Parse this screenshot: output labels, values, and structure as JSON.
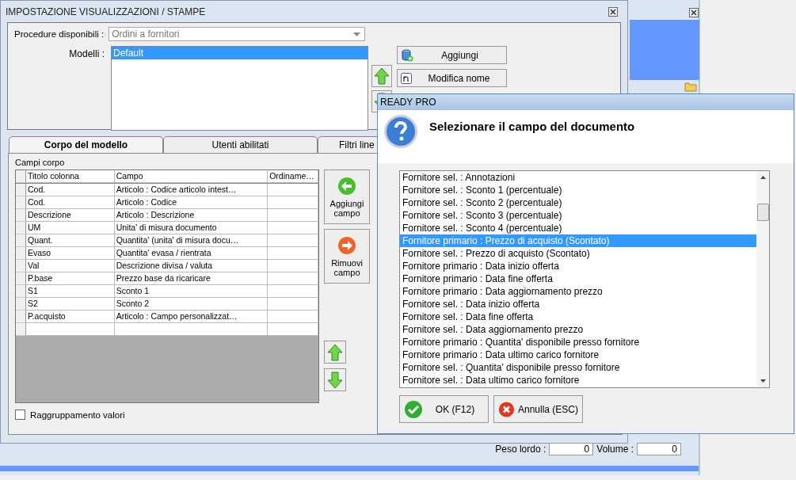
{
  "background_window": {
    "fields": [
      {
        "label": "Peso lordo :",
        "value": "0"
      },
      {
        "label": "Volume :",
        "value": "0"
      }
    ]
  },
  "settings_window": {
    "title": "IMPOSTAZIONE VISUALIZZAZIONI / STAMPE",
    "procedure": {
      "label": "Procedure disponibili :",
      "value": "Ordini a fornitori"
    },
    "models": {
      "label": "Modelli :",
      "items": [
        {
          "name": "Default",
          "selected": true
        }
      ]
    },
    "model_buttons": [
      {
        "label": "Aggiungi",
        "kind": "add"
      },
      {
        "label": "Modifica nome",
        "kind": "rename"
      }
    ],
    "tabs": [
      {
        "label": "Corpo del modello",
        "selected": true
      },
      {
        "label": "Utenti abilitati",
        "selected": false
      },
      {
        "label": "Filtri line",
        "selected": false
      }
    ],
    "section_label": "Campi corpo",
    "table": {
      "columns": [
        "Titolo colonna",
        "Campo",
        "Ordiname…"
      ],
      "rows": [
        [
          "Cod.",
          "Articolo : Codice articolo intest…",
          ""
        ],
        [
          "Cod.",
          "Articolo : Codice",
          ""
        ],
        [
          "Descrizione",
          "Articolo : Descrizione",
          ""
        ],
        [
          "UM",
          "Unita' di misura documento",
          ""
        ],
        [
          "Quant.",
          "Quantita' (unita' di misura docu…",
          ""
        ],
        [
          "Evaso",
          "Quantita' evasa / rientrata",
          ""
        ],
        [
          "Val",
          "Descrizione divisa / valuta",
          ""
        ],
        [
          "P.base",
          "Prezzo base da ricaricare",
          ""
        ],
        [
          "S1",
          "Sconto 1",
          ""
        ],
        [
          "S2",
          "Sconto 2",
          ""
        ],
        [
          "P.acquisto",
          "Articolo : Campo personalizzat…",
          ""
        ],
        [
          "",
          "",
          ""
        ]
      ]
    },
    "side_buttons": [
      {
        "label": "Aggiungi campo",
        "kind": "add"
      },
      {
        "label": "Rimuovi campo",
        "kind": "remove"
      }
    ],
    "grouping": {
      "label": "Raggruppamento valori",
      "checked": false
    }
  },
  "dialog": {
    "title": "READY PRO",
    "heading": "Selezionare il campo del documento",
    "items": [
      {
        "label": "Fornitore sel. : Annotazioni",
        "selected": false
      },
      {
        "label": "Fornitore sel. : Sconto 1 (percentuale)",
        "selected": false
      },
      {
        "label": "Fornitore sel. : Sconto 2 (percentuale)",
        "selected": false
      },
      {
        "label": "Fornitore sel. : Sconto 3 (percentuale)",
        "selected": false
      },
      {
        "label": "Fornitore sel. : Sconto 4 (percentuale)",
        "selected": false
      },
      {
        "label": "Fornitore primario : Prezzo di acquisto (Scontato)",
        "selected": true
      },
      {
        "label": "Fornitore sel. : Prezzo di acquisto (Scontato)",
        "selected": false
      },
      {
        "label": "Fornitore primario : Data inizio offerta",
        "selected": false
      },
      {
        "label": "Fornitore primario : Data fine offerta",
        "selected": false
      },
      {
        "label": "Fornitore primario : Data aggiornamento prezzo",
        "selected": false
      },
      {
        "label": "Fornitore sel. : Data inizio offerta",
        "selected": false
      },
      {
        "label": "Fornitore sel. : Data fine offerta",
        "selected": false
      },
      {
        "label": "Fornitore sel. : Data aggiornamento prezzo",
        "selected": false
      },
      {
        "label": "Fornitore primario : Quantita' disponibile presso fornitore",
        "selected": false
      },
      {
        "label": "Fornitore primario : Data ultimo carico fornitore",
        "selected": false
      },
      {
        "label": "Fornitore sel. : Quantita' disponibile presso fornitore",
        "selected": false
      },
      {
        "label": "Fornitore sel. : Data ultimo carico fornitore",
        "selected": false
      }
    ],
    "buttons": [
      {
        "label": "OK (F12)",
        "kind": "ok"
      },
      {
        "label": "Annulla (ESC)",
        "kind": "cancel"
      }
    ]
  }
}
